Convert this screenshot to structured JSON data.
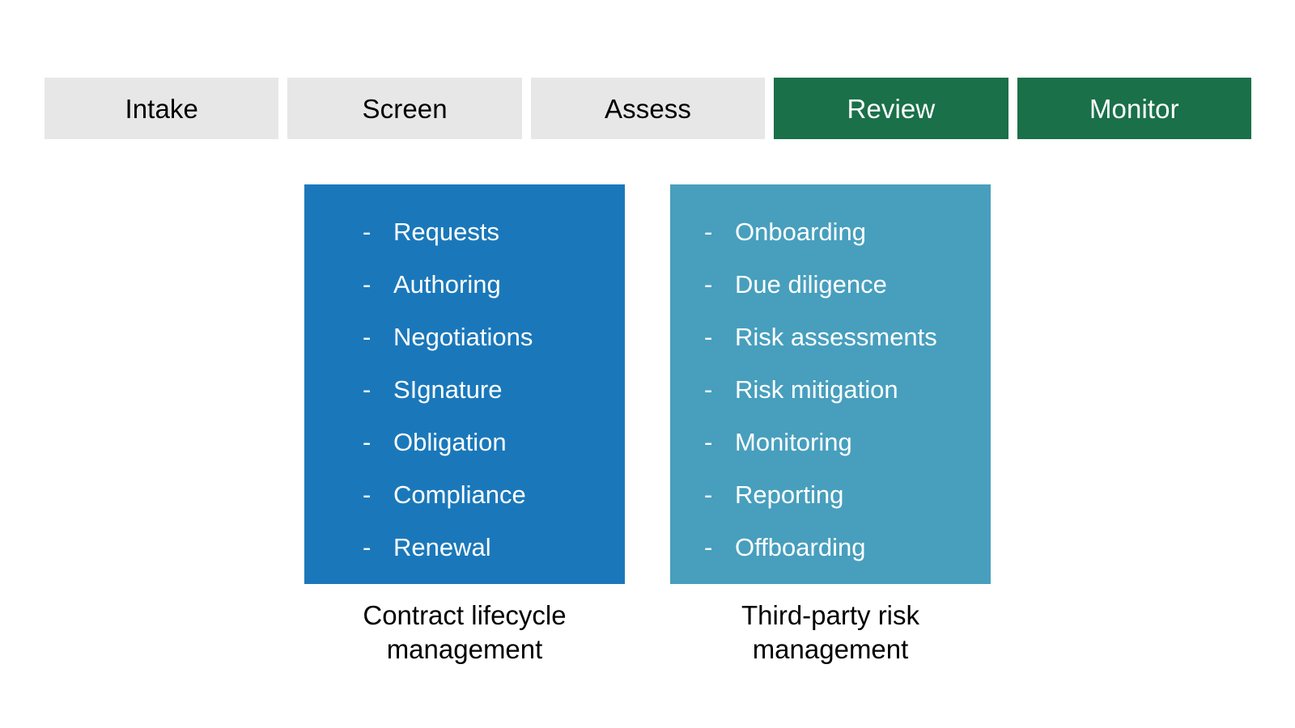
{
  "stage_bar": {
    "tabs": [
      {
        "label": "Intake",
        "state": "inactive"
      },
      {
        "label": "Screen",
        "state": "inactive"
      },
      {
        "label": "Assess",
        "state": "inactive"
      },
      {
        "label": "Review",
        "state": "active"
      },
      {
        "label": "Monitor",
        "state": "active"
      }
    ],
    "inactive_color": "#e7e7e7",
    "inactive_text_color": "#000000",
    "active_color": "#1a7049",
    "active_text_color": "#ffffff"
  },
  "cards": [
    {
      "id": "contract-lifecycle-management",
      "color": "#1a78ba",
      "bullet_marker": "-",
      "items": [
        "Requests",
        "Authoring",
        "Negotiations",
        "SIgnature",
        "Obligation",
        "Compliance",
        "Renewal"
      ],
      "caption_line1": "Contract lifecycle",
      "caption_line2": "management"
    },
    {
      "id": "third-party-risk-management",
      "color": "#479fbd",
      "bullet_marker": "-",
      "items": [
        "Onboarding",
        "Due diligence",
        "Risk assessments",
        "Risk mitigation",
        "Monitoring",
        "Reporting",
        "Offboarding"
      ],
      "caption_line1": "Third-party risk",
      "caption_line2": "management"
    }
  ]
}
